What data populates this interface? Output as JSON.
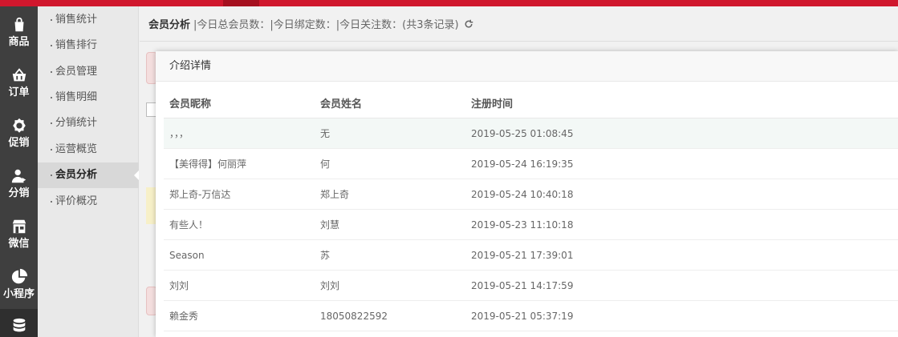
{
  "iconbar": {
    "items": [
      {
        "label": "商品",
        "icon": "shopping-bag-icon"
      },
      {
        "label": "订单",
        "icon": "basket-icon"
      },
      {
        "label": "促销",
        "icon": "sale-badge-icon"
      },
      {
        "label": "分销",
        "icon": "user-share-icon"
      },
      {
        "label": "微信",
        "icon": "wechat-store-icon"
      },
      {
        "label": "小程序",
        "icon": "pie-icon"
      }
    ],
    "active_icon": "database-icon"
  },
  "subnav": {
    "items": [
      {
        "label": "销售统计"
      },
      {
        "label": "销售排行"
      },
      {
        "label": "会员管理"
      },
      {
        "label": "销售明细"
      },
      {
        "label": "分销统计"
      },
      {
        "label": "运营概览"
      },
      {
        "label": "会员分析"
      },
      {
        "label": "评价概况"
      }
    ],
    "active": "会员分析"
  },
  "header": {
    "title": "会员分析",
    "stats": "|今日总会员数：|今日绑定数：|今日关注数：(共3条记录)"
  },
  "modal": {
    "title": "介绍详情",
    "columns": [
      "会员昵称",
      "会员姓名",
      "注册时间"
    ],
    "rows": [
      {
        "nickname": "，，，",
        "name": "无",
        "time": "2019-05-25 01:08:45"
      },
      {
        "nickname": "【美得得】何丽萍",
        "name": "何",
        "time": "2019-05-24 16:19:35"
      },
      {
        "nickname": "郑上奇-万信达",
        "name": "郑上奇",
        "time": "2019-05-24 10:40:18"
      },
      {
        "nickname": "有些人！",
        "name": "刘慧",
        "time": "2019-05-23 11:10:18"
      },
      {
        "nickname": "Season",
        "name": "苏",
        "time": "2019-05-21 17:39:01"
      },
      {
        "nickname": "刘刘",
        "name": "刘刘",
        "time": "2019-05-21 14:17:59"
      },
      {
        "nickname": "赖金秀",
        "name": "18050822592",
        "time": "2019-05-21 05:37:19"
      }
    ]
  },
  "colors": {
    "brand_red": "#d0172d",
    "iconbar_bg": "#3f3f3f",
    "row_highlight": "#f3f8f6"
  }
}
